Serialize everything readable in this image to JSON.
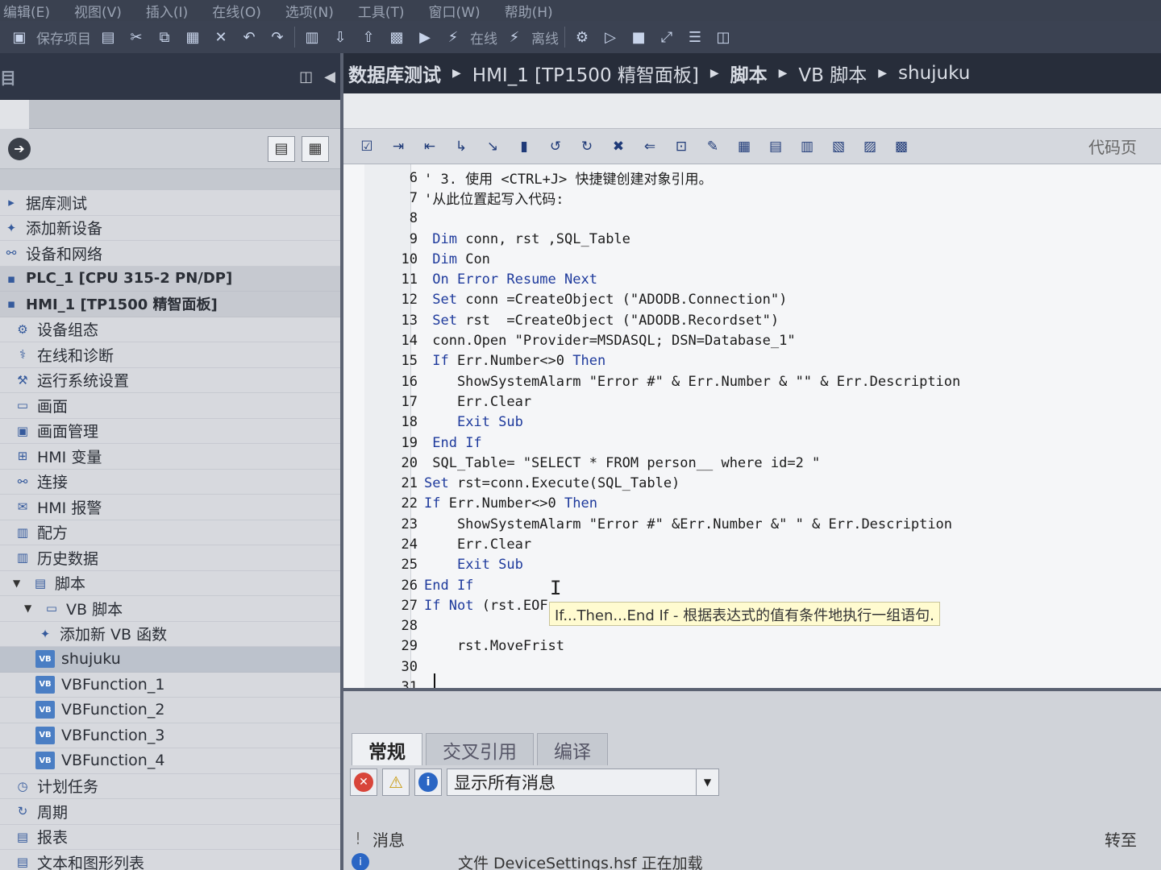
{
  "menu": [
    "编辑(E)",
    "视图(V)",
    "插入(I)",
    "在线(O)",
    "选项(N)",
    "工具(T)",
    "窗口(W)",
    "帮助(H)"
  ],
  "toolbar": {
    "save_label": "保存项目",
    "online_label": "在线",
    "offline_label": "离线"
  },
  "left_panel": {
    "title": "目",
    "tree": [
      {
        "label": "据库测试",
        "icon": "project-icon",
        "indent": 0,
        "kind": "plain"
      },
      {
        "label": "添加新设备",
        "icon": "add-device-icon",
        "indent": 0,
        "kind": "plain"
      },
      {
        "label": "设备和网络",
        "icon": "network-icon",
        "indent": 0,
        "kind": "plain"
      },
      {
        "label": "PLC_1 [CPU 315-2 PN/DP]",
        "icon": "plc-icon",
        "indent": 0,
        "kind": "bold"
      },
      {
        "label": "HMI_1 [TP1500 精智面板]",
        "icon": "hmi-icon",
        "indent": 0,
        "kind": "bold"
      },
      {
        "label": "设备组态",
        "icon": "device-config-icon",
        "indent": 1,
        "kind": "plain"
      },
      {
        "label": "在线和诊断",
        "icon": "diagnostics-icon",
        "indent": 1,
        "kind": "plain"
      },
      {
        "label": "运行系统设置",
        "icon": "runtime-settings-icon",
        "indent": 1,
        "kind": "plain"
      },
      {
        "label": "画面",
        "icon": "screens-folder-icon",
        "indent": 1,
        "kind": "plain"
      },
      {
        "label": "画面管理",
        "icon": "screen-management-icon",
        "indent": 1,
        "kind": "plain"
      },
      {
        "label": "HMI 变量",
        "icon": "hmi-tags-icon",
        "indent": 1,
        "kind": "plain"
      },
      {
        "label": "连接",
        "icon": "connections-icon",
        "indent": 1,
        "kind": "plain"
      },
      {
        "label": "HMI 报警",
        "icon": "hmi-alarms-icon",
        "indent": 1,
        "kind": "plain"
      },
      {
        "label": "配方",
        "icon": "recipes-icon",
        "indent": 1,
        "kind": "plain"
      },
      {
        "label": "历史数据",
        "icon": "historical-data-icon",
        "indent": 1,
        "kind": "plain"
      },
      {
        "label": "脚本",
        "icon": "scripts-folder-icon",
        "indent": 1,
        "kind": "plain"
      },
      {
        "label": "VB 脚本",
        "icon": "vb-folder-icon",
        "indent": 2,
        "kind": "plain"
      },
      {
        "label": "添加新 VB 函数",
        "icon": "add-vb-function-icon",
        "indent": 3,
        "kind": "plain"
      },
      {
        "label": "shujuku",
        "icon": "vb-script-icon",
        "indent": 3,
        "kind": "selected"
      },
      {
        "label": "VBFunction_1",
        "icon": "vb-script-icon",
        "indent": 3,
        "kind": "plain"
      },
      {
        "label": "VBFunction_2",
        "icon": "vb-script-icon",
        "indent": 3,
        "kind": "plain"
      },
      {
        "label": "VBFunction_3",
        "icon": "vb-script-icon",
        "indent": 3,
        "kind": "plain"
      },
      {
        "label": "VBFunction_4",
        "icon": "vb-script-icon",
        "indent": 3,
        "kind": "plain"
      },
      {
        "label": "计划任务",
        "icon": "scheduled-tasks-icon",
        "indent": 1,
        "kind": "plain"
      },
      {
        "label": "周期",
        "icon": "cycles-icon",
        "indent": 1,
        "kind": "plain"
      },
      {
        "label": "报表",
        "icon": "reports-icon",
        "indent": 1,
        "kind": "plain"
      },
      {
        "label": "文本和图形列表",
        "icon": "text-graphic-lists-icon",
        "indent": 1,
        "kind": "plain"
      }
    ]
  },
  "breadcrumb": [
    "数据库测试",
    "HMI_1 [TP1500 精智面板]",
    "脚本",
    "VB 脚本",
    "shujuku"
  ],
  "editor": {
    "code_page_label": "代码页",
    "lines": [
      {
        "n": "6",
        "text": "' 3. 使用 <CTRL+J> 快捷键创建对象引用。"
      },
      {
        "n": "7",
        "text": "'从此位置起写入代码:"
      },
      {
        "n": "8",
        "text": ""
      },
      {
        "n": "9",
        "text": " Dim conn, rst ,SQL_Table"
      },
      {
        "n": "10",
        "text": " Dim Con"
      },
      {
        "n": "11",
        "text": " On Error Resume Next"
      },
      {
        "n": "12",
        "text": " Set conn =CreateObject (\"ADODB.Connection\")"
      },
      {
        "n": "13",
        "text": " Set rst  =CreateObject (\"ADODB.Recordset\")"
      },
      {
        "n": "14",
        "text": " conn.Open \"Provider=MSDASQL; DSN=Database_1\""
      },
      {
        "n": "15",
        "text": " If Err.Number<>0 Then"
      },
      {
        "n": "16",
        "text": "    ShowSystemAlarm \"Error #\" & Err.Number & \"\" & Err.Description"
      },
      {
        "n": "17",
        "text": "    Err.Clear"
      },
      {
        "n": "18",
        "text": "    Exit Sub"
      },
      {
        "n": "19",
        "text": " End If"
      },
      {
        "n": "20",
        "text": " SQL_Table= \"SELECT * FROM person__ where id=2 \""
      },
      {
        "n": "21",
        "text": "Set rst=conn.Execute(SQL_Table)"
      },
      {
        "n": "22",
        "text": "If Err.Number<>0 Then"
      },
      {
        "n": "23",
        "text": "    ShowSystemAlarm \"Error #\" &Err.Number &\" \" & Err.Description"
      },
      {
        "n": "24",
        "text": "    Err.Clear"
      },
      {
        "n": "25",
        "text": "    Exit Sub"
      },
      {
        "n": "26",
        "text": "End If"
      },
      {
        "n": "27",
        "text": "If Not (rst.EOF"
      },
      {
        "n": "28",
        "text": ""
      },
      {
        "n": "29",
        "text": "    rst.MoveFrist"
      },
      {
        "n": "30",
        "text": ""
      },
      {
        "n": "31",
        "text": ""
      }
    ],
    "tooltip": "If...Then...End If - 根据表达式的值有条件地执行一组语句."
  },
  "bottom_panel": {
    "tabs": [
      "常规",
      "交叉引用",
      "编译"
    ],
    "filter_value": "显示所有消息",
    "col_bang": "!",
    "col_message": "消息",
    "goto_label": "转至",
    "message_text": "文件 DeviceSettings.hsf 正在加载"
  }
}
